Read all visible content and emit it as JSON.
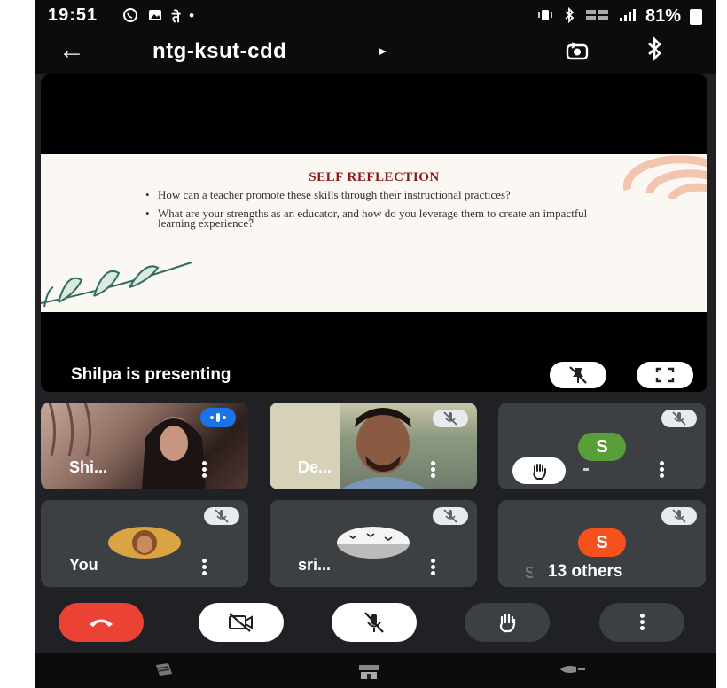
{
  "status_bar": {
    "time": "19:51",
    "battery": "81%"
  },
  "header": {
    "meeting_code": "ntg-ksut-cdd"
  },
  "presentation": {
    "slide": {
      "title": "SELF REFLECTION",
      "bullets": [
        "How can a teacher promote these skills through their instructional practices?",
        "What are your strengths as an educator, and how do you leverage them to create an impactful learning experience?"
      ]
    },
    "presenting_label": "Shilpa is presenting"
  },
  "participants": [
    {
      "name": "Shi...",
      "state": "speaking"
    },
    {
      "name": "De...",
      "state": "muted"
    },
    {
      "name": "",
      "avatar_letter": "S",
      "avatar_color": "#5a9e3a",
      "state": "muted",
      "hand_raised": true
    },
    {
      "name": "You",
      "state": "muted"
    },
    {
      "name": "sri...",
      "state": "muted"
    },
    {
      "name": "Su",
      "avatar_letter": "S",
      "avatar_color": "#f4511e",
      "state": "muted",
      "overlay_label": "13 others"
    }
  ],
  "colors": {
    "end_call": "#ea4335",
    "background": "#202124",
    "tile": "#3c4043",
    "speaking": "#1a73e8"
  },
  "icons": {
    "back": "arrow-left-icon",
    "camera_flip": "camera-flip-icon",
    "bluetooth": "bluetooth-icon",
    "end_call": "phone-hangup-icon",
    "camera_off": "camera-off-icon",
    "mic_off": "mic-off-icon",
    "raise_hand": "hand-icon",
    "more": "more-vertical-icon"
  }
}
